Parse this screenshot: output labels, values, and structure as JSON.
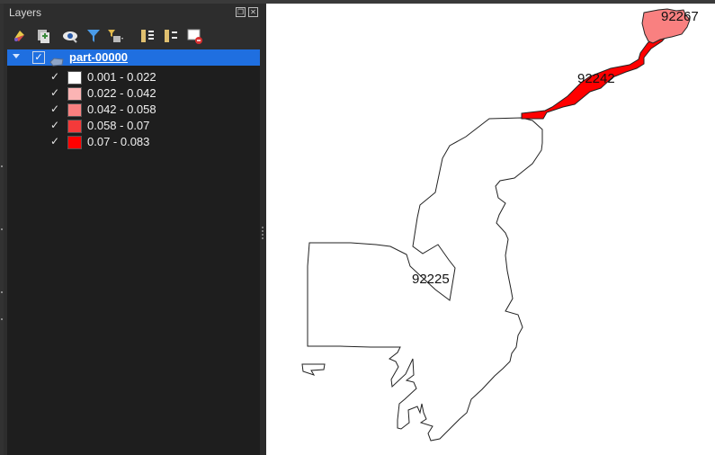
{
  "panel": {
    "title": "Layers",
    "toolbar_icons": [
      "style-icon",
      "add-group-icon",
      "visibility-icon",
      "filter-icon",
      "filter-legend-icon",
      "expand-all-icon",
      "collapse-all-icon",
      "remove-layer-icon"
    ]
  },
  "layer": {
    "name": "part-00000",
    "checked": true,
    "legend": [
      {
        "label": "0.001 - 0.022",
        "color": "#ffffff",
        "checked": true
      },
      {
        "label": "0.022 - 0.042",
        "color": "#fbb4b4",
        "checked": true
      },
      {
        "label": "0.042 - 0.058",
        "color": "#f98080",
        "checked": true
      },
      {
        "label": "0.058 - 0.07",
        "color": "#f43a3a",
        "checked": true
      },
      {
        "label": "0.07 - 0.083",
        "color": "#ff0000",
        "checked": true
      }
    ]
  },
  "map": {
    "labels": [
      "92267",
      "92242",
      "92225"
    ],
    "colors": {
      "zip_92267": "#f98080",
      "zip_92242": "#ff0000",
      "zip_92225": "#ffffff",
      "outline": "#222222"
    }
  }
}
